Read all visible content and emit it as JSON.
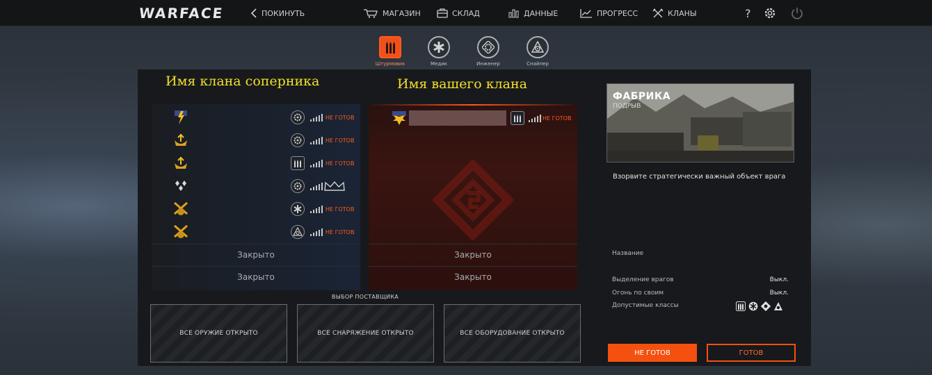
{
  "header": {
    "logo": "WARFACE",
    "leave_label": "ПОКИНУТЬ",
    "nav": [
      {
        "label": "МАГАЗИН",
        "icon": "cart-icon"
      },
      {
        "label": "СКЛАД",
        "icon": "storage-icon"
      },
      {
        "label": "ДАННЫЕ",
        "icon": "stats-icon"
      },
      {
        "label": "ПРОГРЕСС",
        "icon": "progress-icon"
      },
      {
        "label": "КЛАНЫ",
        "icon": "clans-icon"
      }
    ],
    "help_icon": "help-icon",
    "settings_icon": "gear-icon",
    "power_icon": "power-icon"
  },
  "classes": [
    {
      "label": "Штурмовик",
      "icon": "rifleman-icon",
      "active": true
    },
    {
      "label": "Медик",
      "icon": "medic-icon",
      "active": false
    },
    {
      "label": "Инженер",
      "icon": "engineer-icon",
      "active": false
    },
    {
      "label": "Снайпер",
      "icon": "sniper-icon",
      "active": false
    }
  ],
  "teams": {
    "opponent_title": "Имя клана соперника",
    "own_title": "Имя вашего клана",
    "opponent_players": [
      {
        "rank": "rank-lightning-icon",
        "class": "engineer-icon",
        "state": "НЕ ГОТОВ"
      },
      {
        "rank": "rank-crown-icon",
        "class": "engineer-icon",
        "state": "НЕ ГОТОВ"
      },
      {
        "rank": "rank-crown-icon",
        "class": "rifleman-icon",
        "state": "НЕ ГОТОВ"
      },
      {
        "rank": "rank-star-icon",
        "class": "engineer-icon",
        "state": ""
      },
      {
        "rank": "rank-swords-icon",
        "class": "medic-icon",
        "state": "НЕ ГОТОВ"
      },
      {
        "rank": "rank-swords-icon",
        "class": "sniper-icon",
        "state": "НЕ ГОТОВ"
      }
    ],
    "own_players": [
      {
        "rank": "rank-eagle-icon",
        "class": "rifleman-icon",
        "state": "НЕ ГОТОВ"
      }
    ],
    "closed_slots": [
      "Закрыто",
      "Закрыто"
    ]
  },
  "supplier": {
    "title": "ВЫБОР ПОСТАВЩИКА",
    "options": [
      "ВСЕ ОРУЖИЕ ОТКРЫТО",
      "ВСЕ СНАРЯЖЕНИЕ ОТКРЫТО",
      "ВСЕ ОБОРУДОВАНИЕ ОТКРЫТО"
    ]
  },
  "map": {
    "title": "ФАБРИКА",
    "mode": "ПОДРЫВ",
    "description": "Взорвите стратегически важный объект врага",
    "name_label": "Название",
    "options": [
      {
        "label": "Выделение врагов",
        "value": "Выкл."
      },
      {
        "label": "Огонь по своим",
        "value": "Выкл."
      },
      {
        "label": "Допустимые классы",
        "value": ""
      }
    ]
  },
  "actions": {
    "not_ready": "НЕ ГОТОВ",
    "ready": "ГОТОВ"
  },
  "colors": {
    "accent": "#f4500f",
    "clan_title": "#f2e02a",
    "not_ready_text": "#ff5a1f"
  }
}
